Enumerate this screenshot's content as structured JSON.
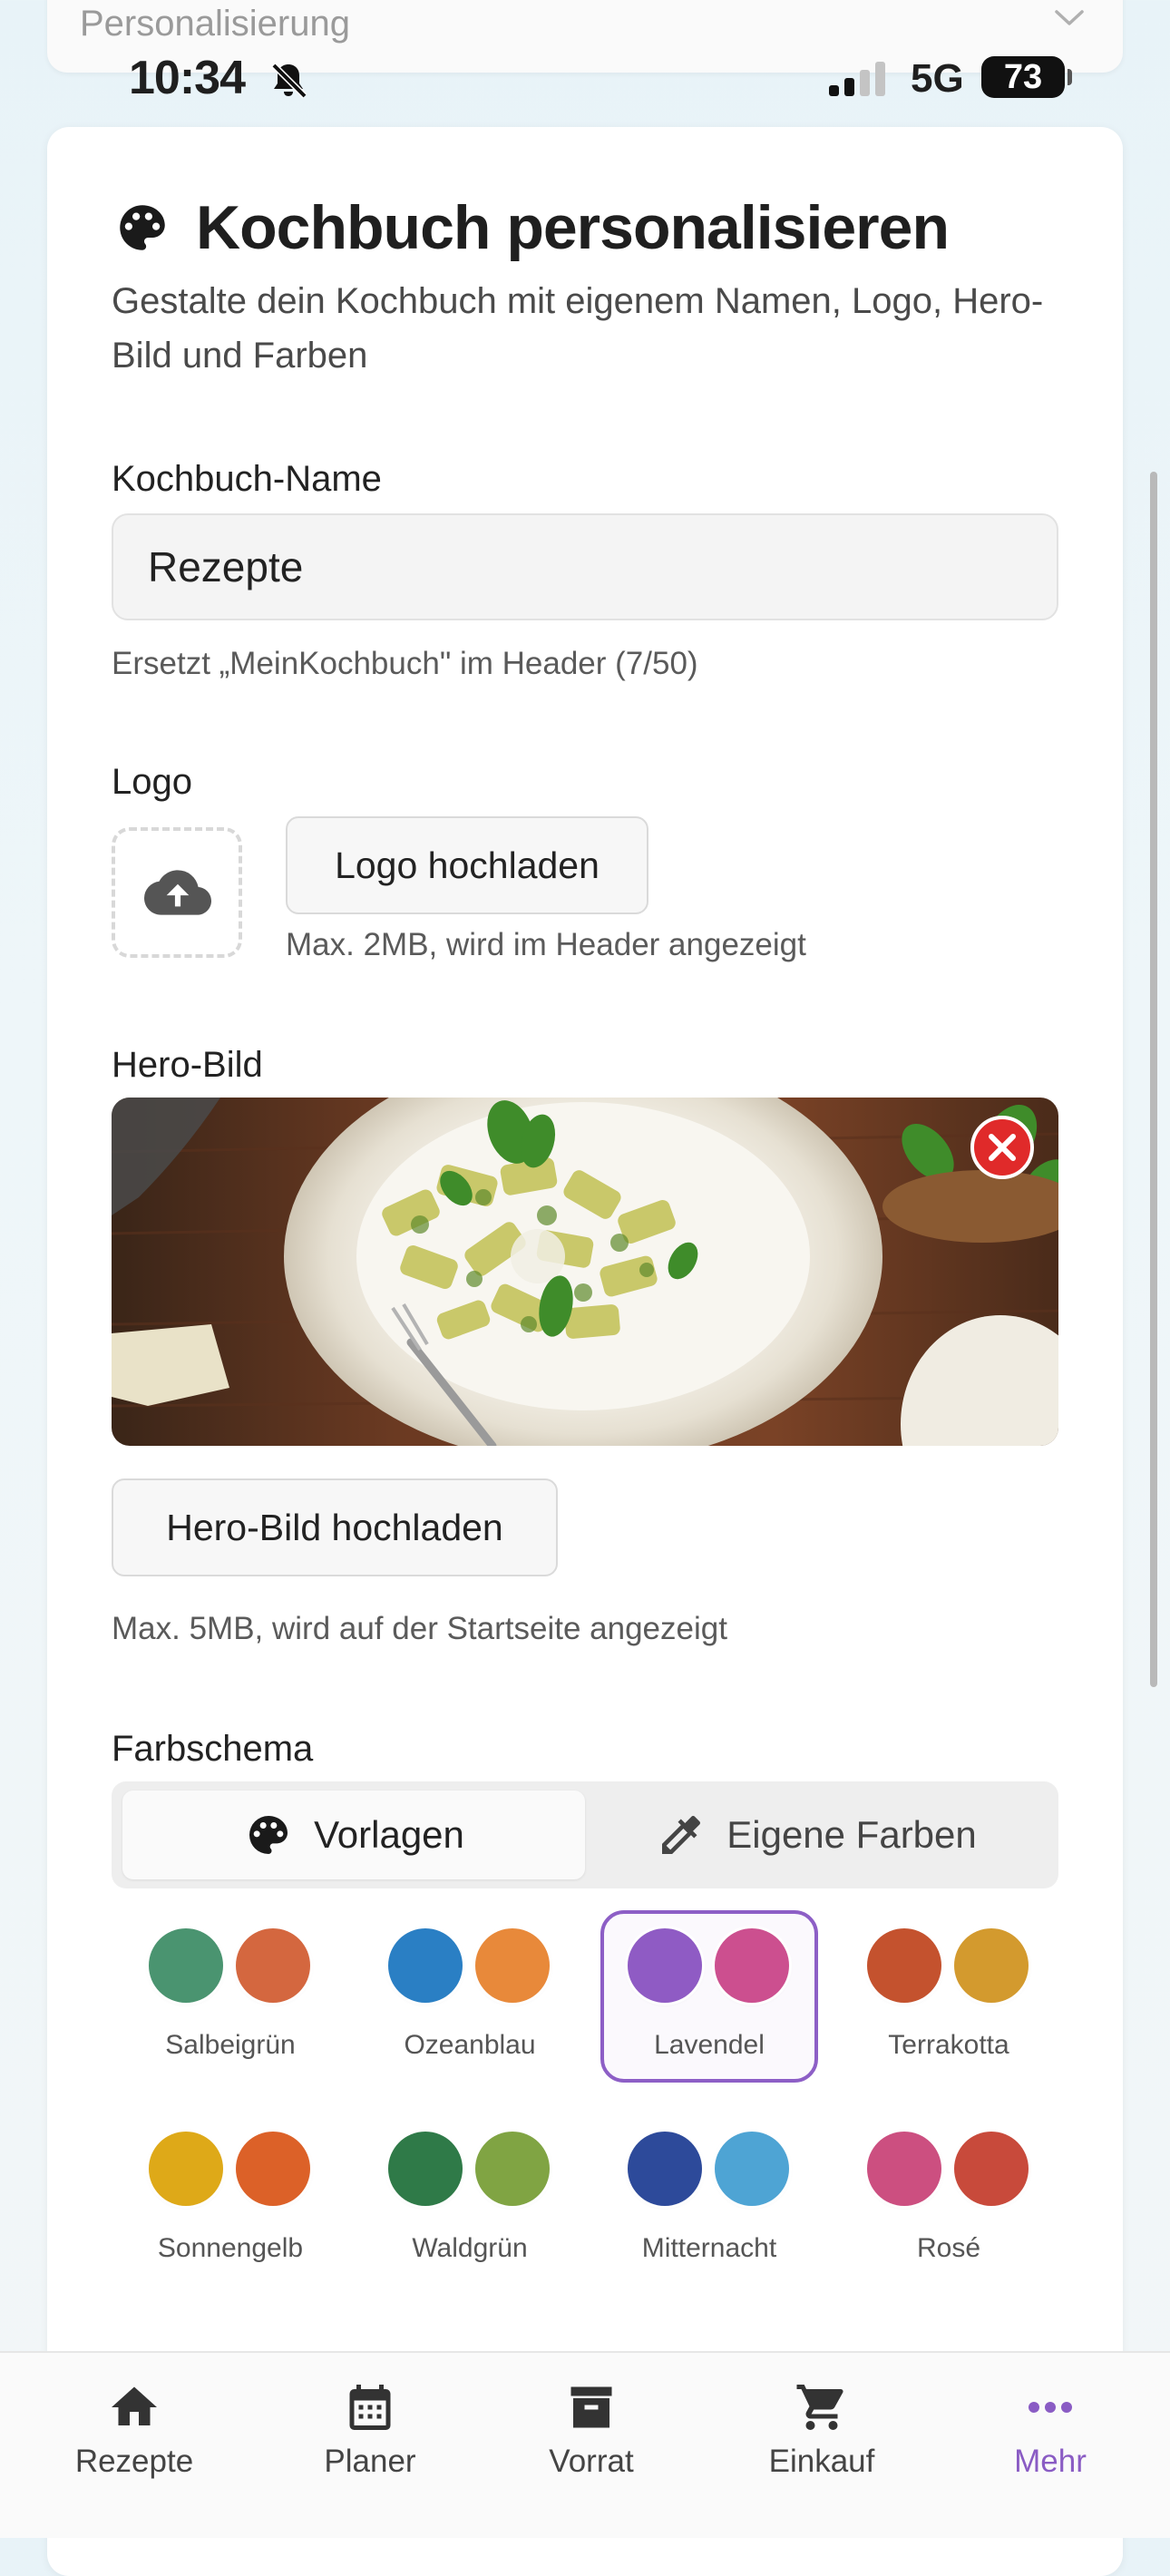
{
  "status_bar": {
    "time": "10:34",
    "network": "5G",
    "battery": "73"
  },
  "previous_section": {
    "label": "Personalisierung"
  },
  "header": {
    "title": "Kochbuch personalisieren",
    "subtitle": "Gestalte dein Kochbuch mit eigenem Namen, Logo, Hero-Bild und Farben"
  },
  "name_field": {
    "label": "Kochbuch-Name",
    "value": "Rezepte",
    "hint": "Ersetzt „MeinKochbuch\" im Header (7/50)"
  },
  "logo": {
    "label": "Logo",
    "button": "Logo hochladen",
    "hint": "Max. 2MB, wird im Header angezeigt"
  },
  "hero": {
    "label": "Hero-Bild",
    "button": "Hero-Bild hochladen",
    "hint": "Max. 5MB, wird auf der Startseite angezeigt"
  },
  "color_scheme": {
    "label": "Farbschema",
    "tabs": [
      {
        "label": "Vorlagen",
        "icon": "palette-icon",
        "active": true
      },
      {
        "label": "Eigene Farben",
        "icon": "eyedropper-icon",
        "active": false
      }
    ],
    "presets": [
      {
        "name": "Salbeigrün",
        "colors": [
          "#4a9470",
          "#d4673f"
        ],
        "selected": false
      },
      {
        "name": "Ozeanblau",
        "colors": [
          "#2a7fc4",
          "#e8893a"
        ],
        "selected": false
      },
      {
        "name": "Lavendel",
        "colors": [
          "#8f5bc4",
          "#cc4f8f"
        ],
        "selected": true
      },
      {
        "name": "Terrakotta",
        "colors": [
          "#c4522e",
          "#d39a2e"
        ],
        "selected": false
      },
      {
        "name": "Sonnengelb",
        "colors": [
          "#dea918",
          "#dc6128"
        ],
        "selected": false
      },
      {
        "name": "Waldgrün",
        "colors": [
          "#2f7a48",
          "#80a443"
        ],
        "selected": false
      },
      {
        "name": "Mitternacht",
        "colors": [
          "#2d4a9a",
          "#4ea4d4"
        ],
        "selected": false
      },
      {
        "name": "Rosé",
        "colors": [
          "#cc4f80",
          "#c84a3b"
        ],
        "selected": false
      }
    ]
  },
  "tab_bar": {
    "items": [
      {
        "label": "Rezepte",
        "icon": "home-icon",
        "active": false
      },
      {
        "label": "Planer",
        "icon": "calendar-icon",
        "active": false
      },
      {
        "label": "Vorrat",
        "icon": "archive-icon",
        "active": false
      },
      {
        "label": "Einkauf",
        "icon": "cart-icon",
        "active": false
      },
      {
        "label": "Mehr",
        "icon": "more-icon",
        "active": true
      }
    ],
    "active_color": "#8a5cc4"
  }
}
